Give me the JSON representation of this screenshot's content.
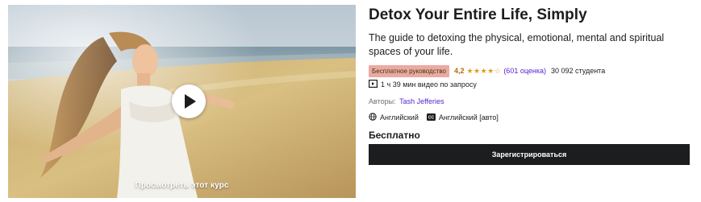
{
  "preview": {
    "label": "Просмотреть этот курс",
    "play_icon": "play-icon"
  },
  "course": {
    "title": "Detox Your Entire Life, Simply",
    "subtitle": "The guide to detoxing the physical, emotional, mental and spiritual spaces of your life.",
    "badge": "Бесплатное руководство",
    "rating": "4,2",
    "stars_value": 4.2,
    "stars_text": "★★★★☆",
    "ratings_count": "(601 оценка)",
    "students": "30 092 студента",
    "video_info": "1 ч 39 мин видео по запросу",
    "authors_label": "Авторы:",
    "author": "Tash Jefferies",
    "language": "Английский",
    "captions": "Английский [авто]",
    "price": "Бесплатно",
    "enroll_label": "Зарегистрироваться"
  },
  "colors": {
    "badge_bg": "#eca9a3",
    "rating": "#b4690e",
    "stars": "#e59819",
    "link": "#5624d0",
    "button_bg": "#1c1d1f"
  }
}
